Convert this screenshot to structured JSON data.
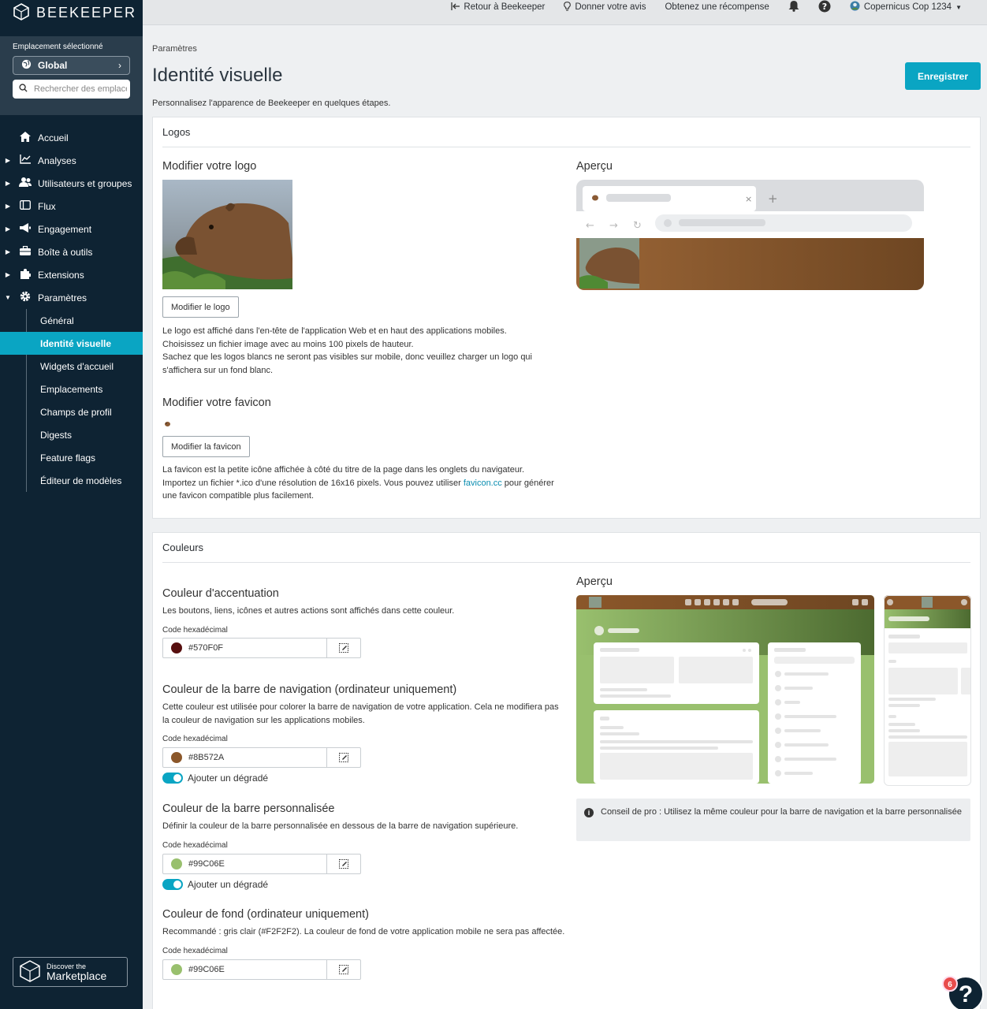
{
  "brand": {
    "name": "BEEKEEPER"
  },
  "location": {
    "label": "Emplacement sélectionné",
    "selected": "Global",
    "search_placeholder": "Rechercher des emplacements"
  },
  "nav": {
    "items": [
      {
        "label": "Accueil",
        "icon": "home-icon"
      },
      {
        "label": "Analyses",
        "icon": "chart-icon"
      },
      {
        "label": "Utilisateurs et groupes",
        "icon": "users-icon"
      },
      {
        "label": "Flux",
        "icon": "stream-icon"
      },
      {
        "label": "Engagement",
        "icon": "megaphone-icon"
      },
      {
        "label": "Boîte à outils",
        "icon": "toolbox-icon"
      },
      {
        "label": "Extensions",
        "icon": "puzzle-icon"
      },
      {
        "label": "Paramètres",
        "icon": "gear-icon"
      }
    ],
    "sub_items": [
      "Général",
      "Identité visuelle",
      "Widgets d'accueil",
      "Emplacements",
      "Champs de profil",
      "Digests",
      "Feature flags",
      "Éditeur de modèles"
    ],
    "active_sub": "Identité visuelle"
  },
  "marketplace": {
    "small": "Discover the",
    "big": "Marketplace"
  },
  "topbar": {
    "back": "Retour à Beekeeper",
    "feedback": "Donner votre avis",
    "reward": "Obtenez une récompense",
    "account": "Copernicus Cop 1234"
  },
  "page": {
    "breadcrumb": "Paramètres",
    "title": "Identité visuelle",
    "save": "Enregistrer",
    "subtitle": "Personnalisez l'apparence de Beekeeper en quelques étapes."
  },
  "logos": {
    "section": "Logos",
    "logo_title": "Modifier votre logo",
    "logo_button": "Modifier le logo",
    "logo_help": [
      "Le logo est affiché dans l'en-tête de l'application Web et en haut des applications mobiles.",
      "Choisissez un fichier image avec au moins 100 pixels de hauteur.",
      "Sachez que les logos blancs ne seront pas visibles sur mobile, donc veuillez charger un logo qui",
      "s'affichera sur un fond blanc."
    ],
    "favicon_title": "Modifier votre favicon",
    "favicon_button": "Modifier la favicon",
    "favicon_help_1": "La favicon est la petite icône affichée à côté du titre de la page dans les onglets du navigateur.",
    "favicon_help_2a": "Importez un fichier *.ico d'une résolution de 16x16 pixels. Vous pouvez utiliser ",
    "favicon_link": "favicon.cc",
    "favicon_help_2b": " pour générer",
    "favicon_help_3": "une favicon compatible plus facilement.",
    "preview_title": "Aperçu"
  },
  "colors": {
    "section": "Couleurs",
    "preview_title": "Aperçu",
    "hex_label": "Code hexadécimal",
    "gradient_label": "Ajouter un dégradé",
    "accent": {
      "title": "Couleur d'accentuation",
      "help": "Les boutons, liens, icônes et autres actions sont affichés dans cette couleur.",
      "hex": "#570F0F"
    },
    "navbar": {
      "title": "Couleur de la barre de navigation (ordinateur uniquement)",
      "help_1": "Cette couleur est utilisée pour colorer la barre de navigation de votre application. Cela ne modifiera pas",
      "help_2": "la couleur de navigation sur les applications mobiles.",
      "hex": "#8B572A"
    },
    "custom_bar": {
      "title": "Couleur de la barre personnalisée",
      "help": "Définir la couleur de la barre personnalisée en dessous de la barre de navigation supérieure.",
      "hex": "#99C06E"
    },
    "background": {
      "title": "Couleur de fond (ordinateur uniquement)",
      "help": "Recommandé : gris clair (#F2F2F2). La couleur de fond de votre application mobile ne sera pas affectée.",
      "hex": "#99C06E"
    },
    "tip": "Conseil de pro : Utilisez la même couleur pour la barre de navigation et la barre personnalisée"
  },
  "help": {
    "badge": "6",
    "glyph": "?"
  },
  "palette": {
    "accent": "#0aa5c3",
    "sidebar": "#0e2333",
    "brown": "#8B572A",
    "green": "#99C06E",
    "dark_red": "#570F0F"
  }
}
